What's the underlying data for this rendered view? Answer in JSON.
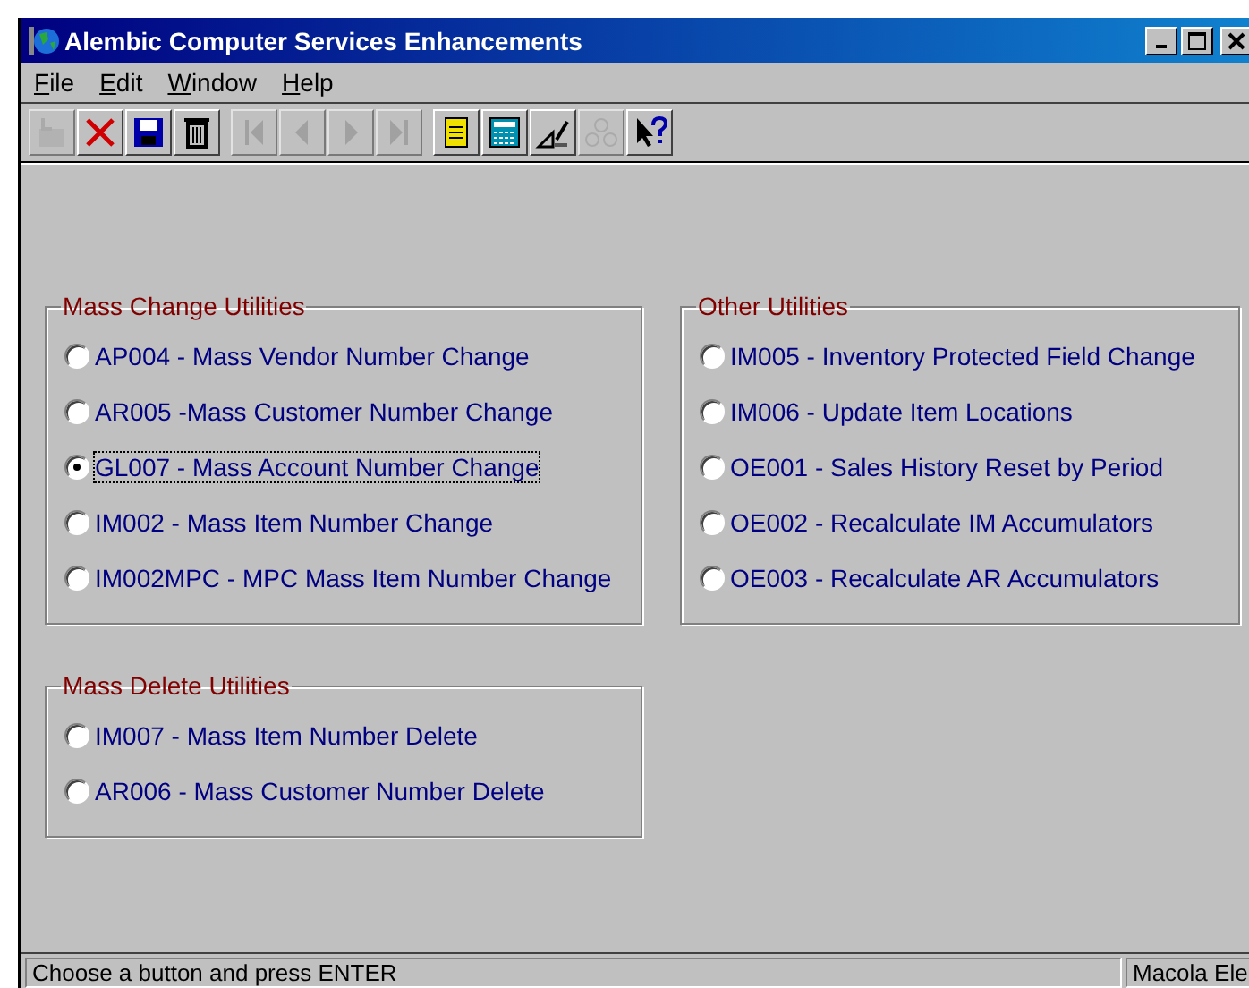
{
  "window": {
    "title": "Alembic Computer Services Enhancements"
  },
  "menu": [
    {
      "label": "File"
    },
    {
      "label": "Edit"
    },
    {
      "label": "Window"
    },
    {
      "label": "Help"
    }
  ],
  "toolbar": [
    [
      {
        "kind": "insert",
        "disabled": true
      },
      {
        "kind": "delete",
        "disabled": false
      },
      {
        "kind": "save",
        "disabled": false
      },
      {
        "kind": "trash",
        "disabled": false
      }
    ],
    [
      {
        "kind": "first",
        "disabled": true
      },
      {
        "kind": "prev",
        "disabled": true
      },
      {
        "kind": "next",
        "disabled": true
      },
      {
        "kind": "last",
        "disabled": true
      }
    ],
    [
      {
        "kind": "note",
        "disabled": false
      },
      {
        "kind": "calc",
        "disabled": false
      },
      {
        "kind": "draw",
        "disabled": false
      },
      {
        "kind": "group",
        "disabled": true
      },
      {
        "kind": "help",
        "disabled": false
      }
    ]
  ],
  "groups": [
    {
      "title": "Mass Change Utilities",
      "options": [
        {
          "label": "AP004 - Mass Vendor Number Change",
          "selected": false
        },
        {
          "label": "AR005 -Mass Customer Number Change",
          "selected": false
        },
        {
          "label": "GL007 - Mass Account Number Change",
          "selected": true
        },
        {
          "label": "IM002 - Mass Item Number Change",
          "selected": false
        },
        {
          "label": "IM002MPC - MPC Mass Item Number Change",
          "selected": false
        }
      ]
    },
    {
      "title": "Other Utilities",
      "options": [
        {
          "label": "IM005 - Inventory Protected Field Change",
          "selected": false
        },
        {
          "label": "IM006 - Update Item Locations",
          "selected": false
        },
        {
          "label": "OE001 - Sales History Reset by Period",
          "selected": false
        },
        {
          "label": "OE002 - Recalculate IM Accumulators",
          "selected": false
        },
        {
          "label": "OE003 - Recalculate AR Accumulators",
          "selected": false
        }
      ]
    },
    {
      "title": "Mass Delete Utilities",
      "options": [
        {
          "label": "IM007 - Mass Item Number Delete",
          "selected": false
        },
        {
          "label": "AR006 - Mass Customer Number Delete",
          "selected": false
        }
      ]
    }
  ],
  "status_bar": {
    "message": "Choose a button and press ENTER",
    "app": "Macola Ele"
  }
}
